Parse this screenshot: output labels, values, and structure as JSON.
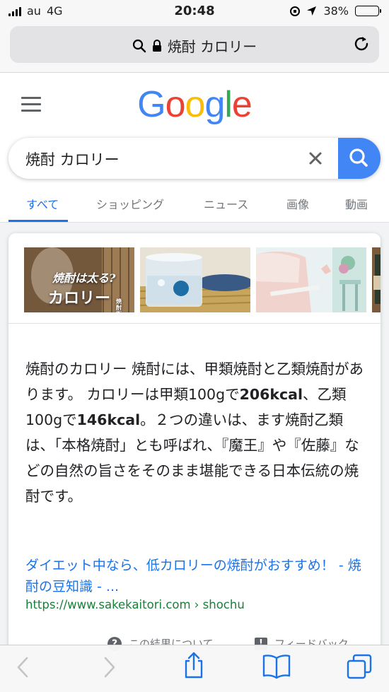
{
  "status_bar": {
    "carrier": "au",
    "network": "4G",
    "time": "20:48",
    "battery": "38%",
    "battery_level": 0.38
  },
  "browser": {
    "address": "焼酎 カロリー",
    "icons": [
      "search-icon",
      "lock-icon",
      "reload-icon"
    ]
  },
  "google": {
    "logo": [
      "G",
      "o",
      "o",
      "g",
      "l",
      "e"
    ],
    "logo_colors": [
      "#4285F4",
      "#EA4335",
      "#FBBC05",
      "#4285F4",
      "#34A853",
      "#EA4335"
    ]
  },
  "search": {
    "query": "焼酎 カロリー",
    "accent": "#4285f4"
  },
  "tabs": [
    {
      "label": "すべて",
      "active": true
    },
    {
      "label": "ショッピング",
      "active": false
    },
    {
      "label": "ニュース",
      "active": false
    },
    {
      "label": "画像",
      "active": false
    },
    {
      "label": "動画",
      "active": false
    }
  ],
  "result": {
    "images": [
      {
        "caption_line1": "焼酎は太る?",
        "caption_line2": "カロリー",
        "caption_mark": "焼酎街道"
      },
      {
        "caption_line1": "",
        "caption_line2": "",
        "caption_mark": ""
      },
      {
        "caption_line1": "",
        "caption_line2": "",
        "caption_mark": ""
      }
    ],
    "snippet": {
      "part1": "焼酎のカロリー 焼酎には、甲類焼酎と乙類焼酎があります。 カロリーは甲類100gで",
      "bold1": "206kcal",
      "part2": "、乙類100gで",
      "bold2": "146kcal",
      "part3": "。２つの違いは、ます焼酎乙類は、「本格焼酎」とも呼ばれ、『魔王』や『佐藤』などの自然の旨さをそのまま堪能できる日本伝統の焼酎です。"
    },
    "title": "ダイエット中なら、低カロリーの焼酎がおすすめ！ - 焼酎の豆知識 - ...",
    "url": "https://www.sakekaitori.com › shochu",
    "about": "この結果について",
    "feedback": "フィードバック"
  },
  "toolbar": {
    "icons": [
      "back-icon",
      "forward-icon",
      "share-icon",
      "bookmarks-icon",
      "tabs-icon"
    ]
  }
}
